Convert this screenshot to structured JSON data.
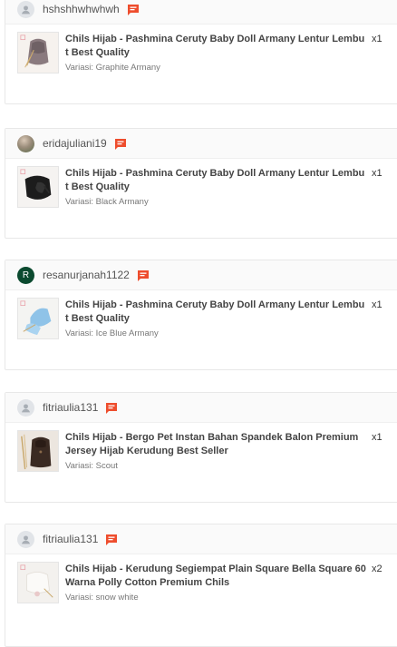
{
  "orders": [
    {
      "username": "hshshhwhwhwh",
      "avatar": "default-avatar-icon",
      "product": "Chils Hijab - Pashmina Ceruty Baby Doll Armany Lentur Lembut Best Quality",
      "variation": "Variasi: Graphite Armany",
      "quantity": "x1",
      "thumb": "graphite-hijab-image"
    },
    {
      "username": "eridajuliani19",
      "avatar": "photo-avatar",
      "product": "Chils Hijab - Pashmina Ceruty Baby Doll Armany Lentur Lembut Best Quality",
      "variation": "Variasi: Black Armany",
      "quantity": "x1",
      "thumb": "black-hijab-image"
    },
    {
      "username": "resanurjanah1122",
      "avatar": "R",
      "product": "Chils Hijab - Pashmina Ceruty Baby Doll Armany Lentur Lembut Best Quality",
      "variation": "Variasi: Ice Blue Armany",
      "quantity": "x1",
      "thumb": "ice-blue-hijab-image"
    },
    {
      "username": "fitriaulia131",
      "avatar": "default-avatar-icon",
      "product": "Chils Hijab - Bergo Pet Instan Bahan Spandek Balon Premium Jersey Hijab Kerudung Best Seller",
      "variation": "Variasi: Scout",
      "quantity": "x1",
      "thumb": "scout-bergo-image"
    },
    {
      "username": "fitriaulia131",
      "avatar": "default-avatar-icon",
      "product": "Chils Hijab - Kerudung Segiempat Plain Square Bella Square 60 Warna Polly Cotton Premium Chils",
      "variation": "Variasi: snow white",
      "quantity": "x2",
      "thumb": "snow-white-square-image"
    }
  ],
  "colors": {
    "chat_icon": "#ee4d2d",
    "border": "#e8e8e8",
    "header_bg": "#fafafa"
  }
}
